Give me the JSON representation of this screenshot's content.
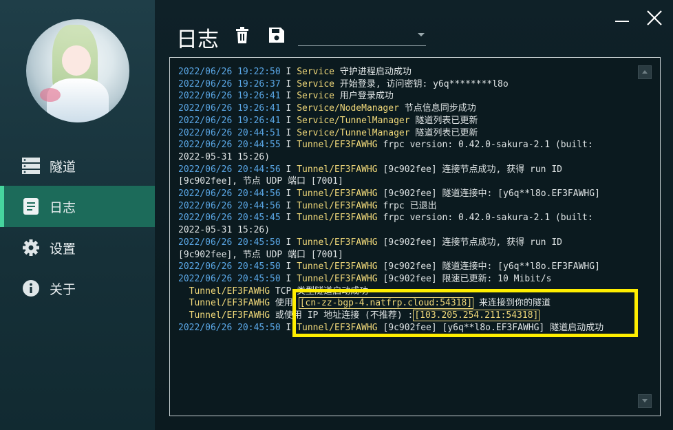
{
  "nav": [
    {
      "label": "隧道",
      "icon": "server-icon"
    },
    {
      "label": "日志",
      "icon": "document-icon",
      "active": true
    },
    {
      "label": "设置",
      "icon": "gear-icon"
    },
    {
      "label": "关于",
      "icon": "info-icon"
    }
  ],
  "header": {
    "title": "日志",
    "select_value": ""
  },
  "colors": {
    "accent": "#46d59e",
    "active_bg": "#1c6b5a",
    "timestamp": "#5aa7e6",
    "highlight": "#f1d97a",
    "annotation": "#ffee00"
  },
  "log": [
    {
      "ts": "2022/06/26 19:22:50",
      "lvl": "I",
      "src": "Service",
      "msg": "守护进程启动成功"
    },
    {
      "ts": "2022/06/26 19:26:37",
      "lvl": "I",
      "src": "Service",
      "msg": "开始登录, 访问密钥: y6q********l8o"
    },
    {
      "ts": "2022/06/26 19:26:41",
      "lvl": "I",
      "src": "Service",
      "msg": "用户登录成功"
    },
    {
      "ts": "2022/06/26 19:26:41",
      "lvl": "I",
      "src": "Service/NodeManager",
      "msg": "节点信息同步成功"
    },
    {
      "ts": "2022/06/26 19:26:41",
      "lvl": "I",
      "src": "Service/TunnelManager",
      "msg": "隧道列表已更新"
    },
    {
      "ts": "2022/06/26 20:44:51",
      "lvl": "I",
      "src": "Service/TunnelManager",
      "msg": "隧道列表已更新"
    },
    {
      "ts": "2022/06/26 20:44:55",
      "lvl": "I",
      "src": "Tunnel/EF3FAWHG",
      "msg": "frpc version: 0.42.0-sakura-2.1 (built:"
    },
    {
      "cont": "2022-05-31 15:26)"
    },
    {
      "ts": "2022/06/26 20:44:56",
      "lvl": "I",
      "src": "Tunnel/EF3FAWHG",
      "msg": "[9c902fee] 连接节点成功, 获得 run ID"
    },
    {
      "cont": "[9c902fee], 节点 UDP 端口 [7001]"
    },
    {
      "ts": "2022/06/26 20:44:56",
      "lvl": "I",
      "src": "Tunnel/EF3FAWHG",
      "msg": "[9c902fee] 隧道连接中: [y6q**l8o.EF3FAWHG]"
    },
    {
      "ts": "2022/06/26 20:44:56",
      "lvl": "I",
      "src": "Tunnel/EF3FAWHG",
      "msg": "frpc 已退出"
    },
    {
      "ts": "2022/06/26 20:45:45",
      "lvl": "I",
      "src": "Tunnel/EF3FAWHG",
      "msg": "frpc version: 0.42.0-sakura-2.1 (built:"
    },
    {
      "cont": "2022-05-31 15:26)"
    },
    {
      "ts": "2022/06/26 20:45:50",
      "lvl": "I",
      "src": "Tunnel/EF3FAWHG",
      "msg": "[9c902fee] 连接节点成功, 获得 run ID"
    },
    {
      "cont": "[9c902fee], 节点 UDP 端口 [7001]"
    },
    {
      "ts": "2022/06/26 20:45:50",
      "lvl": "I",
      "src": "Tunnel/EF3FAWHG",
      "msg": "[9c902fee] 隧道连接中: [y6q**l8o.EF3FAWHG]"
    },
    {
      "ts": "2022/06/26 20:45:50",
      "lvl": "I",
      "src": "Tunnel/EF3FAWHG",
      "msg": "[9c902fee] 限速已更新: 10 Mibit/s"
    },
    {
      "indent": "  ",
      "src": "Tunnel/EF3FAWHG",
      "msg": "TCP 类型隧道启动成功"
    },
    {
      "indent": "  ",
      "src": "Tunnel/EF3FAWHG",
      "msg": "使用 ",
      "hl": "[cn-zz-bgp-4.natfrp.cloud:54318]",
      "after": " 来连接到你的隧道"
    },
    {
      "indent": "  ",
      "src": "Tunnel/EF3FAWHG",
      "msg": "或使用 IP 地址连接 (不推荐) :",
      "hl": "[103.205.254.211:54318]",
      "after": ""
    },
    {
      "ts": "2022/06/26 20:45:50",
      "lvl": "I",
      "src": "Tunnel/EF3FAWHG",
      "msg": "[9c902fee] [y6q**l8o.EF3FAWHG] 隧道启动成功"
    }
  ]
}
